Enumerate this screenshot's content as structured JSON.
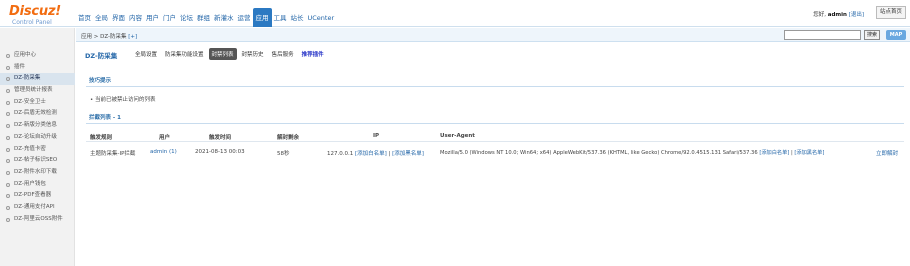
{
  "header": {
    "logo_title": "Discuz!",
    "logo_sub": "Control Panel",
    "nav": [
      "首页",
      "全局",
      "界面",
      "内容",
      "用户",
      "门户",
      "论坛",
      "群组",
      "新灌水",
      "运营",
      "应用",
      "工具",
      "站长",
      "UCenter"
    ],
    "active_nav": "应用",
    "greeting": "您好,",
    "username": "admin",
    "logout": "[退出]",
    "home_button": "站点首页"
  },
  "crumbbar": {
    "breadcrumb": "应用 > DZ-防采集",
    "plus": "[+]",
    "search_value": "",
    "search_button": "搜索",
    "map_button": "MAP"
  },
  "sidebar": {
    "items": [
      "应用中心",
      "插件",
      "DZ-防采集",
      "管理员统计报表",
      "DZ-安全卫士",
      "DZ-后盾无效检测",
      "DZ-新版分类信息",
      "DZ-论坛自动升级",
      "DZ-充值卡密",
      "DZ-帖子标识SEO",
      "DZ-附件水印下载",
      "DZ-用户钱包",
      "DZ-PDF查看器",
      "DZ-通用支付API",
      "DZ-阿里云OSS附件"
    ],
    "active_index": 2
  },
  "main": {
    "title": "DZ-防采集",
    "tabs": [
      "全局设置",
      "防采集功能设置",
      "封禁列表",
      "封禁历史",
      "售后服务",
      "推荐插件"
    ],
    "active_tab": "封禁列表",
    "highlight_tab": "推荐插件",
    "tips_title": "技巧提示",
    "tips": [
      "当前已被禁止访问的列表"
    ],
    "list_title": "拦截列表 - 1",
    "columns": [
      "触发规则",
      "用户",
      "触发时间",
      "解封剩余",
      "IP",
      "User-Agent"
    ],
    "rows": [
      {
        "rule": "主题防采集-IP拦截",
        "user": "admin (1)",
        "time": "2021-08-13 00:03",
        "remaining": "58秒",
        "ip": "127.0.0.1",
        "ip_whitelist": "[添加白名单]",
        "ip_sep": "|",
        "ip_blacklist": "[添加黑名单]",
        "user_agent": "Mozilla/5.0 (Windows NT 10.0; Win64; x64) AppleWebKit/537.36 (KHTML, like Gecko) Chrome/92.0.4515.131 Safari/537.36",
        "ua_whitelist": "[添加白名单]",
        "ua_sep": "|",
        "ua_blacklist": "[添加黑名单]",
        "action": "立即解封"
      }
    ]
  },
  "colors": {
    "logo_orange": "#f26c10",
    "link_blue": "#2366a8",
    "active_nav_bg": "#2b79c2",
    "section_blue": "#2d6fa9",
    "active_tab_bg": "#555555",
    "highlight_tab": "#2a37c8"
  }
}
